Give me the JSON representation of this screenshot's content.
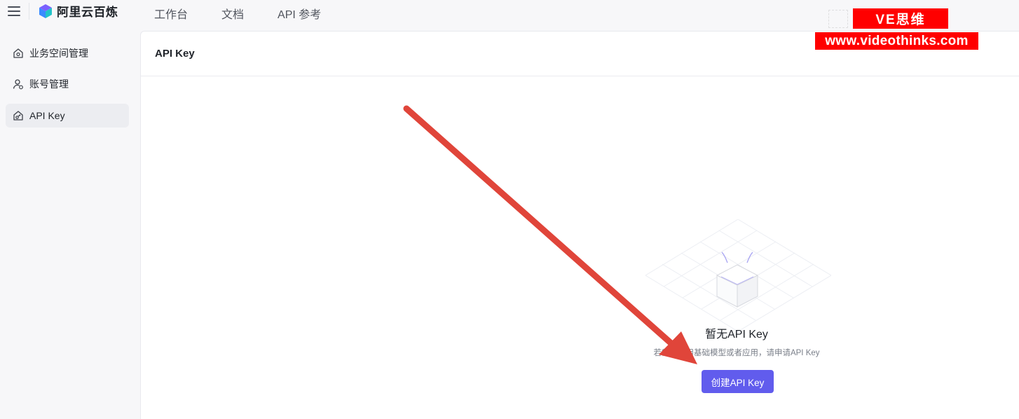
{
  "topbar": {
    "brand": "阿里云百炼",
    "nav": [
      "工作台",
      "文档",
      "API 参考"
    ]
  },
  "sidebar": {
    "items": [
      {
        "label": "业务空间管理",
        "icon": "workspace-icon",
        "active": false
      },
      {
        "label": "账号管理",
        "icon": "account-icon",
        "active": false
      },
      {
        "label": "API Key",
        "icon": "api-key-icon",
        "active": true
      }
    ]
  },
  "main": {
    "title": "API Key",
    "empty_title": "暂无API Key",
    "empty_desc": "若需要调用基础模型或者应用，请申请API Key",
    "create_label": "创建API Key"
  },
  "watermark": {
    "line1": "VE思维",
    "line2": "www.videothinks.com"
  },
  "colors": {
    "accent": "#615ced",
    "annotation_arrow": "#e0453a",
    "watermark_bg": "#ff0000"
  }
}
